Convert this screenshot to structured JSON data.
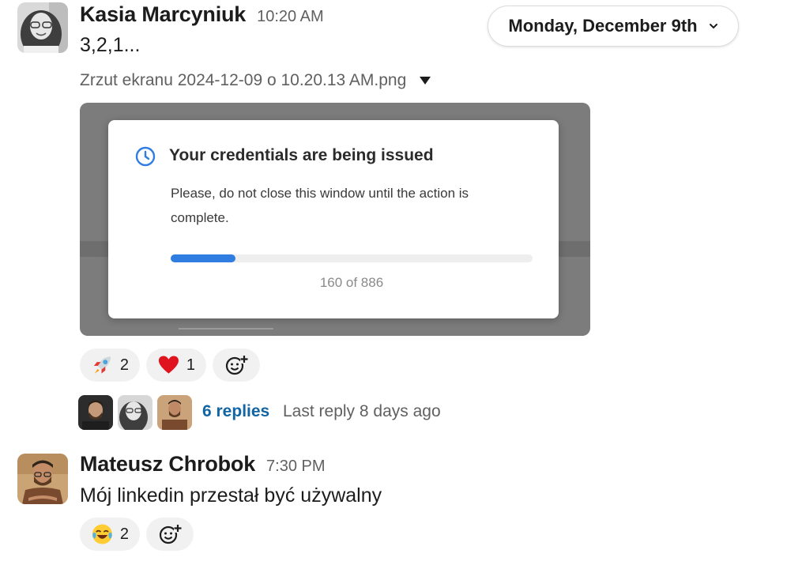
{
  "day_divider": {
    "label": "Monday, December 9th"
  },
  "messages": [
    {
      "author": "Kasia Marcyniuk",
      "time": "10:20 AM",
      "text": "3,2,1...",
      "file": {
        "name": "Zrzut ekranu 2024-12-09 o 10.20.13 AM.png",
        "dialog": {
          "title": "Your credentials are being issued",
          "body": "Please, do not close this window until the action is complete.",
          "progress_text": "160 of 886",
          "progress_fraction": 0.18
        }
      },
      "reactions": [
        {
          "emoji": "rocket",
          "count": "2"
        },
        {
          "emoji": "heart",
          "count": "1"
        }
      ],
      "thread": {
        "replies_label": "6 replies",
        "last_reply_label": "Last reply 8 days ago"
      }
    },
    {
      "author": "Mateusz Chrobok",
      "time": "7:30 PM",
      "text": "Mój linkedin przestał być używalny",
      "reactions": [
        {
          "emoji": "joy",
          "count": "2"
        }
      ]
    }
  ],
  "colors": {
    "link": "#1264a3",
    "progress": "#2f7de1",
    "reaction_bg": "#f1f1f1"
  }
}
